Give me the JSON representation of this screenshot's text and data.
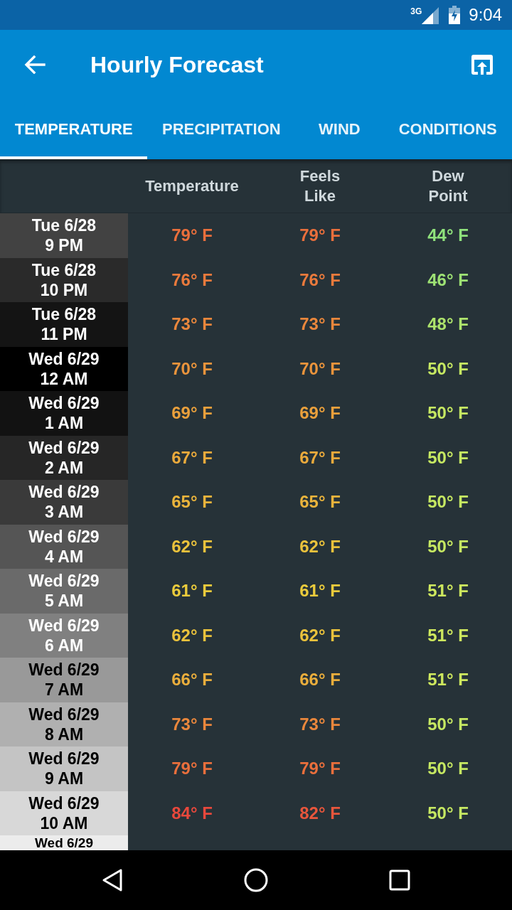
{
  "status_bar": {
    "network": "3G",
    "time": "9:04"
  },
  "app_bar": {
    "title": "Hourly Forecast"
  },
  "tabs": [
    {
      "label": "TEMPERATURE",
      "selected": true
    },
    {
      "label": "PRECIPITATION",
      "selected": false
    },
    {
      "label": "WIND",
      "selected": false
    },
    {
      "label": "CONDITIONS",
      "selected": false
    }
  ],
  "table": {
    "columns": [
      "Temperature",
      "Feels Like",
      "Dew Point"
    ],
    "rows": [
      {
        "day": "Tue 6/28",
        "time": "9 PM",
        "color": "#424242",
        "values": [
          {
            "text": "79° F",
            "color": "#ea6f3c"
          },
          {
            "text": "79° F",
            "color": "#ea6f3c"
          },
          {
            "text": "44° F",
            "color": "#8fe27c"
          }
        ]
      },
      {
        "day": "Tue 6/28",
        "time": "10 PM",
        "color": "#2a2a2a",
        "values": [
          {
            "text": "76° F",
            "color": "#ea7a3c"
          },
          {
            "text": "76° F",
            "color": "#ea7a3c"
          },
          {
            "text": "46° F",
            "color": "#9ee274"
          }
        ]
      },
      {
        "day": "Tue 6/28",
        "time": "11 PM",
        "color": "#141414",
        "values": [
          {
            "text": "73° F",
            "color": "#ea873c"
          },
          {
            "text": "73° F",
            "color": "#ea873c"
          },
          {
            "text": "48° F",
            "color": "#aee46c"
          }
        ]
      },
      {
        "day": "Wed 6/29",
        "time": "12 AM",
        "color": "#000000",
        "values": [
          {
            "text": "70° F",
            "color": "#ea943c"
          },
          {
            "text": "70° F",
            "color": "#ea943c"
          },
          {
            "text": "50° F",
            "color": "#c6e862"
          }
        ]
      },
      {
        "day": "Wed 6/29",
        "time": "1 AM",
        "color": "#121212",
        "values": [
          {
            "text": "69° F",
            "color": "#eaa03c"
          },
          {
            "text": "69° F",
            "color": "#eaa03c"
          },
          {
            "text": "50° F",
            "color": "#c6e862"
          }
        ]
      },
      {
        "day": "Wed 6/29",
        "time": "2 AM",
        "color": "#262626",
        "values": [
          {
            "text": "67° F",
            "color": "#eaaa3c"
          },
          {
            "text": "67° F",
            "color": "#eaaa3c"
          },
          {
            "text": "50° F",
            "color": "#c6e862"
          }
        ]
      },
      {
        "day": "Wed 6/29",
        "time": "3 AM",
        "color": "#3a3a3a",
        "values": [
          {
            "text": "65° F",
            "color": "#eab43c"
          },
          {
            "text": "65° F",
            "color": "#eab43c"
          },
          {
            "text": "50° F",
            "color": "#c6e862"
          }
        ]
      },
      {
        "day": "Wed 6/29",
        "time": "4 AM",
        "color": "#555555",
        "values": [
          {
            "text": "62° F",
            "color": "#eac23c"
          },
          {
            "text": "62° F",
            "color": "#eac23c"
          },
          {
            "text": "50° F",
            "color": "#c6e862"
          }
        ]
      },
      {
        "day": "Wed 6/29",
        "time": "5 AM",
        "color": "#6a6a6a",
        "values": [
          {
            "text": "61° F",
            "color": "#eacb3c"
          },
          {
            "text": "61° F",
            "color": "#eacb3c"
          },
          {
            "text": "51° F",
            "color": "#cee85e"
          }
        ]
      },
      {
        "day": "Wed 6/29",
        "time": "6 AM",
        "color": "#808080",
        "values": [
          {
            "text": "62° F",
            "color": "#eac23c"
          },
          {
            "text": "62° F",
            "color": "#eac23c"
          },
          {
            "text": "51° F",
            "color": "#cee85e"
          }
        ]
      },
      {
        "day": "Wed 6/29",
        "time": "7 AM",
        "color": "#999999",
        "values": [
          {
            "text": "66° F",
            "color": "#eaae3c"
          },
          {
            "text": "66° F",
            "color": "#eaae3c"
          },
          {
            "text": "51° F",
            "color": "#cee85e"
          }
        ]
      },
      {
        "day": "Wed 6/29",
        "time": "8 AM",
        "color": "#b0b0b0",
        "values": [
          {
            "text": "73° F",
            "color": "#ea873c"
          },
          {
            "text": "73° F",
            "color": "#ea873c"
          },
          {
            "text": "50° F",
            "color": "#c6e862"
          }
        ]
      },
      {
        "day": "Wed 6/29",
        "time": "9 AM",
        "color": "#c4c4c4",
        "values": [
          {
            "text": "79° F",
            "color": "#ea6f3c"
          },
          {
            "text": "79° F",
            "color": "#ea6f3c"
          },
          {
            "text": "50° F",
            "color": "#c6e862"
          }
        ]
      },
      {
        "day": "Wed 6/29",
        "time": "10 AM",
        "color": "#d8d8d8",
        "values": [
          {
            "text": "84° F",
            "color": "#e8483c"
          },
          {
            "text": "82° F",
            "color": "#e8563c"
          },
          {
            "text": "50° F",
            "color": "#c6e862"
          }
        ]
      },
      {
        "day": "Wed 6/29",
        "color": "#ececec"
      }
    ]
  }
}
